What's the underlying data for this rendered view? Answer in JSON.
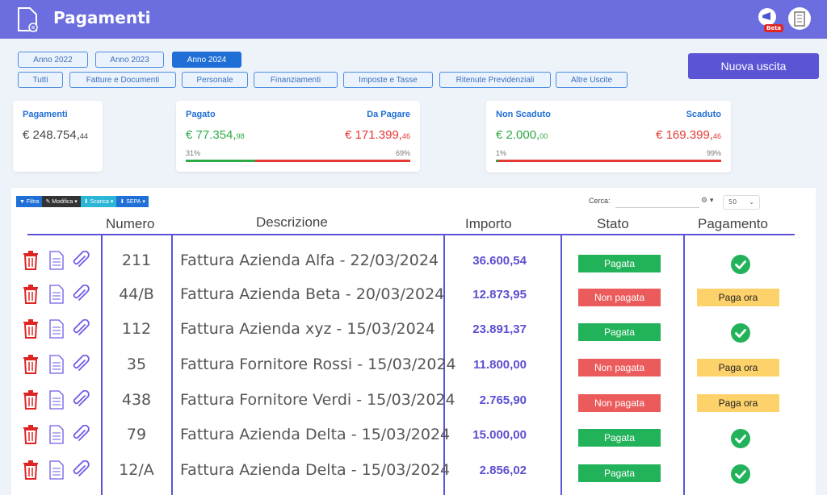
{
  "header": {
    "title": "Pagamenti",
    "beta_label": "Beta"
  },
  "years": [
    "Anno 2022",
    "Anno 2023",
    "Anno 2024"
  ],
  "active_year": "Anno 2024",
  "categories": [
    "Tutti",
    "Fatture e Documenti",
    "Personale",
    "Finanziamenti",
    "Imposte e Tasse",
    "Ritenute Previdenziali",
    "Altre Uscite"
  ],
  "new_button": "Nuova uscita",
  "summary": {
    "pagamenti": {
      "label": "Pagamenti",
      "amount": "€ 248.754,",
      "cents": "44"
    },
    "pagato": {
      "label": "Pagato",
      "amount": "€ 77.354,",
      "cents": "98",
      "pct": "31%",
      "fraction": 0.31
    },
    "da_pagare": {
      "label": "Da Pagare",
      "amount": "€ 171.399,",
      "cents": "46",
      "pct": "69%"
    },
    "non_scaduto": {
      "label": "Non Scaduto",
      "amount": "€ 2.000,",
      "cents": "00",
      "pct": "1%",
      "fraction": 0.01
    },
    "scaduto": {
      "label": "Scaduto",
      "amount": "€ 169.399,",
      "cents": "46",
      "pct": "99%"
    }
  },
  "toolbar": {
    "filtra": "Filtra",
    "modifica": "Modifica",
    "scarica": "Scarica",
    "sepa": "SEPA",
    "cerca_label": "Cerca:",
    "per_page": "50"
  },
  "columns": {
    "numero": "Numero",
    "descrizione": "Descrizione",
    "importo": "Importo",
    "stato": "Stato",
    "pagamento": "Pagamento"
  },
  "rows": [
    {
      "numero": "211",
      "descrizione": "Fattura Azienda Alfa - 22/03/2024",
      "importo": "36.600,54",
      "stato": "Pagata",
      "paid": true
    },
    {
      "numero": "44/B",
      "descrizione": "Fattura Azienda Beta - 20/03/2024",
      "importo": "12.873,95",
      "stato": "Non pagata",
      "paid": false,
      "pay_label": "Paga ora"
    },
    {
      "numero": "112",
      "descrizione": "Fattura Azienda xyz - 15/03/2024",
      "importo": "23.891,37",
      "stato": "Pagata",
      "paid": true
    },
    {
      "numero": "35",
      "descrizione": "Fattura Fornitore Rossi - 15/03/2024",
      "importo": "11.800,00",
      "stato": "Non pagata",
      "paid": false,
      "pay_label": "Paga ora"
    },
    {
      "numero": "438",
      "descrizione": "Fattura Fornitore Verdi - 15/03/2024",
      "importo": "2.765,90",
      "stato": "Non pagata",
      "paid": false,
      "pay_label": "Paga ora"
    },
    {
      "numero": "79",
      "descrizione": "Fattura Azienda Delta - 15/03/2024",
      "importo": "15.000,00",
      "stato": "Pagata",
      "paid": true
    },
    {
      "numero": "12/A",
      "descrizione": "Fattura Azienda Delta - 15/03/2024",
      "importo": "2.856,02",
      "stato": "Pagata",
      "paid": true
    }
  ]
}
